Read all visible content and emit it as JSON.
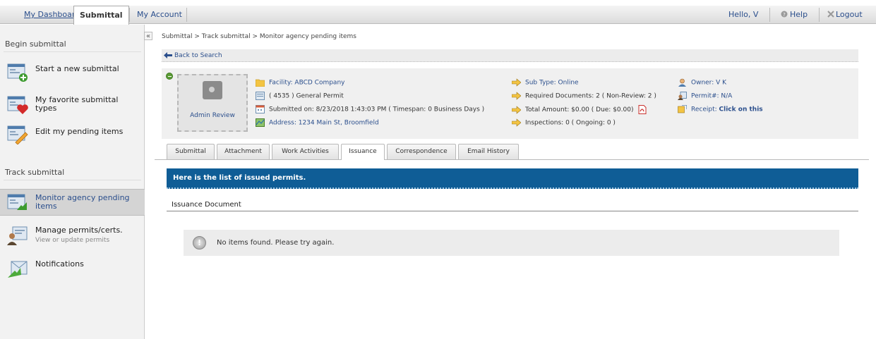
{
  "topnav": {
    "tabs": [
      {
        "label": "My Dashboard"
      },
      {
        "label": "Submittal"
      },
      {
        "label": "My Account"
      }
    ],
    "greeting": "Hello, V",
    "help_label": "Help",
    "logout_label": "Logout"
  },
  "sidebar": {
    "begin_title": "Begin submittal",
    "begin_items": [
      {
        "label": "Start a new submittal"
      },
      {
        "label": "My favorite submittal types"
      },
      {
        "label": "Edit my pending items"
      }
    ],
    "track_title": "Track submittal",
    "track_items": [
      {
        "label": "Monitor agency pending items",
        "selected": true
      },
      {
        "label": "Manage permits/certs.",
        "sublabel": "View or update permits"
      },
      {
        "label": "Notifications"
      }
    ],
    "collapse_glyph": "«"
  },
  "main": {
    "breadcrumb": "Submittal > Track submittal > Monitor agency pending items",
    "back_label": "Back to Search",
    "stamp_label": "Admin Review",
    "info": {
      "facility": "Facility: ABCD Company",
      "permit_type": "( 4535 )  General Permit",
      "submitted": "Submitted on: 8/23/2018 1:43:03 PM ( Timespan: 0 Business Days )",
      "address": "Address: 1234 Main St, Broomfield",
      "sub_type": "Sub Type: Online",
      "required_docs": "Required Documents: 2 ( Non-Review: 2 )",
      "total_amount": "Total Amount: $0.00 ( Due: $0.00)",
      "inspections": "Inspections: 0 ( Ongoing: 0 )",
      "owner": "Owner: V K",
      "permit_no": "Permit#: N/A",
      "receipt_label": "Receipt:",
      "receipt_link": "Click on this"
    },
    "tabs": [
      {
        "label": "Submittal"
      },
      {
        "label": "Attachment"
      },
      {
        "label": "Work Activities"
      },
      {
        "label": "Issuance",
        "active": true
      },
      {
        "label": "Correspondence"
      },
      {
        "label": "Email History"
      }
    ],
    "banner": "Here is the list of issued permits.",
    "section_header": "Issuance Document",
    "empty_message": "No items found. Please try again.",
    "empty_icon_glyph": "!"
  },
  "colors": {
    "banner": "#0f5d96",
    "link": "#2a4e8c",
    "status_ok": "#5b9b35"
  }
}
